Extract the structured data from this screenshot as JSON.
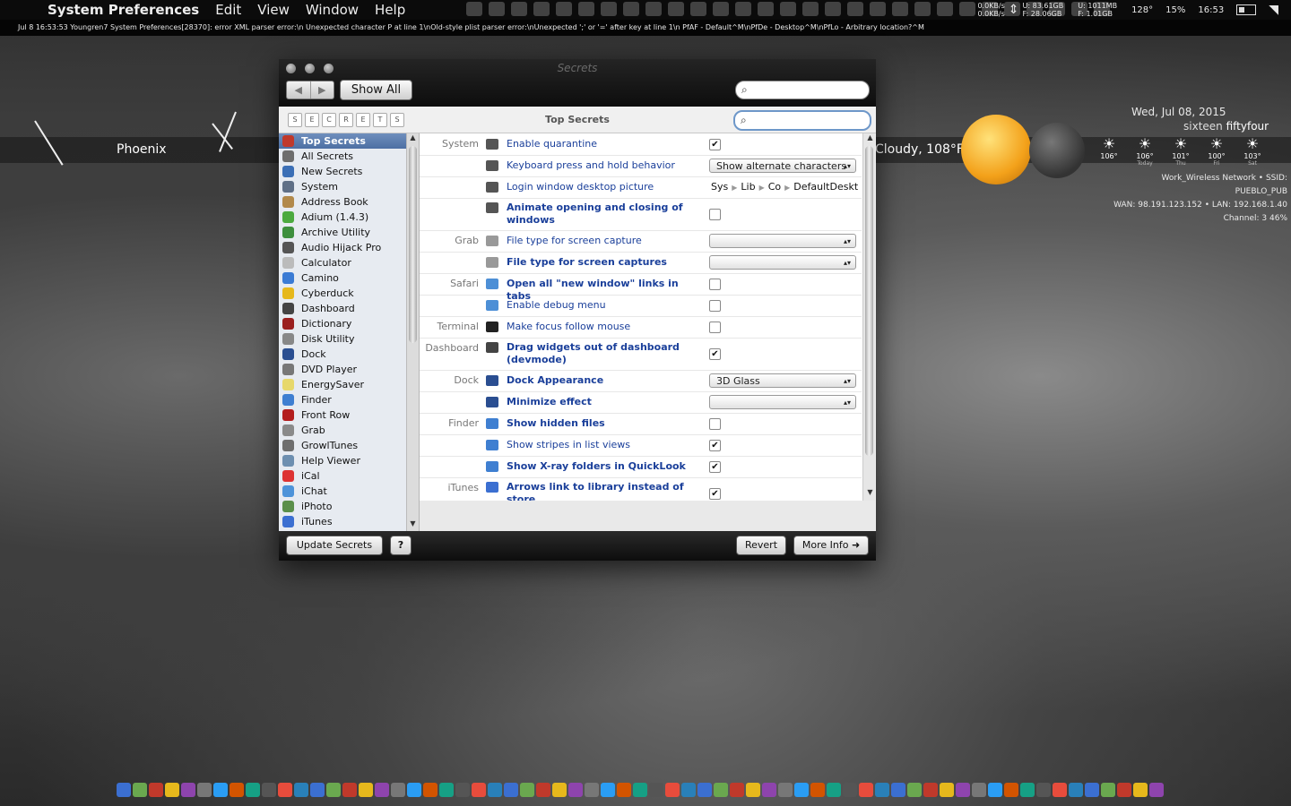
{
  "menubar": {
    "app_name": "System Preferences",
    "menus": [
      "Edit",
      "View",
      "Window",
      "Help"
    ],
    "net_up": "0.0KB/s",
    "net_down": "0.0KB/s",
    "disk_u1": "U: 83.61GB",
    "disk_f1": "F: 28.06GB",
    "disk_u2": "U: 1011MB",
    "disk_f2": "F: 1.01GB",
    "temperature": "128°",
    "cpu": "15%",
    "time": "16:53"
  },
  "console_line": "Jul 8 16:53:53 Youngren7 System Preferences[28370]: error XML parser error:\\n    Unexpected character P at line 1\\nOld-style plist parser error:\\nUnexpected ';' or '=' after key at line 1\\n PfAF - Default^M\\nPfDe - Desktop^M\\nPfLo - Arbitrary location?^M",
  "desktop": {
    "city": "Phoenix",
    "weather_text": "Cloudy, 108°F",
    "date": "Wed, Jul 08, 2015",
    "clock_words_a": "sixteen",
    "clock_words_b": "fiftyfour",
    "forecast": [
      {
        "temp": "106°",
        "label": ""
      },
      {
        "temp": "106°",
        "label": "Today"
      },
      {
        "temp": "101°",
        "label": "Thu"
      },
      {
        "temp": "100°",
        "label": "Fri"
      },
      {
        "temp": "103°",
        "label": "Sat"
      }
    ],
    "net_line1": "Work_Wireless Network • SSID: PUEBLO_PUB",
    "net_line2": "WAN: 98.191.123.152 • LAN: 192.168.1.40",
    "net_line3": "Channel: 3        46%"
  },
  "window": {
    "title": "Secrets",
    "show_all": "Show All",
    "letters": [
      "S",
      "E",
      "C",
      "R",
      "E",
      "T",
      "S"
    ],
    "section_title": "Top Secrets",
    "sidebar": [
      {
        "label": "Top Secrets",
        "selected": true,
        "color": "#c0392b"
      },
      {
        "label": "All Secrets",
        "color": "#6d6d6d"
      },
      {
        "label": "New Secrets",
        "color": "#3b6fb6"
      },
      {
        "label": "System",
        "color": "#5f6f86"
      },
      {
        "label": "Address Book",
        "color": "#b2894a"
      },
      {
        "label": "Adium (1.4.3)",
        "color": "#4caa3f"
      },
      {
        "label": "Archive Utility",
        "color": "#3d8f3d"
      },
      {
        "label": "Audio Hijack Pro",
        "color": "#555"
      },
      {
        "label": "Calculator",
        "color": "#bbb"
      },
      {
        "label": "Camino",
        "color": "#3b7bd4"
      },
      {
        "label": "Cyberduck",
        "color": "#e6b81c"
      },
      {
        "label": "Dashboard",
        "color": "#444"
      },
      {
        "label": "Dictionary",
        "color": "#9b1f1f"
      },
      {
        "label": "Disk Utility",
        "color": "#888"
      },
      {
        "label": "Dock",
        "color": "#2a4e91"
      },
      {
        "label": "DVD Player",
        "color": "#777"
      },
      {
        "label": "EnergySaver",
        "color": "#e7d86b"
      },
      {
        "label": "Finder",
        "color": "#3f7fd1"
      },
      {
        "label": "Front Row",
        "color": "#b31d1d"
      },
      {
        "label": "Grab",
        "color": "#8a8a8a"
      },
      {
        "label": "GrowlTunes",
        "color": "#6e6e6e"
      },
      {
        "label": "Help Viewer",
        "color": "#6d8fb0"
      },
      {
        "label": "iCal",
        "color": "#d33"
      },
      {
        "label": "iChat",
        "color": "#4d93d9"
      },
      {
        "label": "iPhoto",
        "color": "#5a8f4a"
      },
      {
        "label": "iTunes",
        "color": "#3b6fd1"
      }
    ],
    "rows": [
      {
        "cat": "System",
        "label": "Enable quarantine",
        "bold": false,
        "control": "check",
        "checked": true,
        "icon": "#555"
      },
      {
        "cat": "",
        "label": "Keyboard press and hold behavior",
        "bold": false,
        "control": "popup",
        "value": "Show alternate characters",
        "icon": "#555"
      },
      {
        "cat": "",
        "label": "Login window desktop picture",
        "bold": false,
        "control": "path",
        "path": [
          "Sys",
          "Lib",
          "Co",
          "DefaultDeskt"
        ],
        "icon": "#555"
      },
      {
        "cat": "",
        "label": "Animate opening and closing of windows",
        "bold": true,
        "control": "check",
        "checked": false,
        "icon": "#555",
        "tall": true
      },
      {
        "cat": "Grab",
        "label": "File type for screen capture",
        "bold": false,
        "control": "popup",
        "value": "",
        "icon": "#999"
      },
      {
        "cat": "",
        "label": "File type for screen captures",
        "bold": true,
        "control": "popup",
        "value": "",
        "icon": "#999"
      },
      {
        "cat": "Safari",
        "label": "Open all \"new window\" links in tabs",
        "bold": true,
        "control": "check",
        "checked": false,
        "icon": "#4d8fd6"
      },
      {
        "cat": "",
        "label": "Enable debug menu",
        "bold": false,
        "control": "check",
        "checked": false,
        "icon": "#4d8fd6"
      },
      {
        "cat": "Terminal",
        "label": "Make focus follow mouse",
        "bold": false,
        "control": "check",
        "checked": false,
        "icon": "#222"
      },
      {
        "cat": "Dashboard",
        "label": "Drag widgets out of dashboard (devmode)",
        "bold": true,
        "control": "check",
        "checked": true,
        "icon": "#444",
        "tall": true
      },
      {
        "cat": "Dock",
        "label": "Dock Appearance",
        "bold": true,
        "control": "popup",
        "value": "3D Glass",
        "icon": "#2a4e91"
      },
      {
        "cat": "",
        "label": "Minimize effect",
        "bold": true,
        "control": "popup",
        "value": "",
        "icon": "#2a4e91"
      },
      {
        "cat": "Finder",
        "label": "Show hidden files",
        "bold": true,
        "control": "check",
        "checked": false,
        "icon": "#3f7fd1"
      },
      {
        "cat": "",
        "label": "Show stripes in list views",
        "bold": false,
        "control": "check",
        "checked": true,
        "icon": "#3f7fd1"
      },
      {
        "cat": "",
        "label": "Show X-ray folders in QuickLook",
        "bold": true,
        "control": "check",
        "checked": true,
        "icon": "#3f7fd1"
      },
      {
        "cat": "iTunes",
        "label": "Arrows link to library instead of store",
        "bold": true,
        "control": "check",
        "checked": true,
        "icon": "#3b6fd1",
        "tall": true
      }
    ],
    "buttons": {
      "update": "Update Secrets",
      "help": "?",
      "revert": "Revert",
      "more_info": "More Info"
    }
  }
}
